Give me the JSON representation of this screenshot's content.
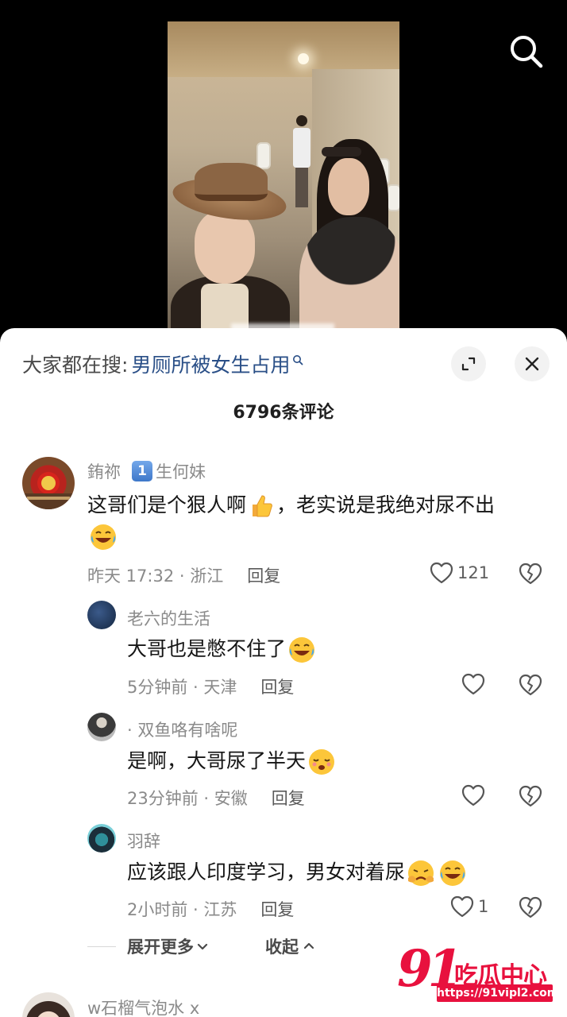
{
  "search_suggestion": {
    "label": "大家都在搜:",
    "term": "男厕所被女生占用"
  },
  "comment_count": "6796条评论",
  "comments": [
    {
      "username": "銪祢",
      "badge": "1",
      "badge_text": "生何妹",
      "text": "这哥们是个狠人啊",
      "text_after_emoji": "，老实说是我绝对尿不出",
      "emojis": [
        "thumbs-up",
        "crying-laughing"
      ],
      "time_location": "昨天 17:32 · 浙江",
      "reply_label": "回复",
      "likes": "121"
    },
    {
      "username": "老六的生活",
      "text": "大哥也是憋不住了",
      "emojis": [
        "crying-laughing"
      ],
      "time_location": "5分钟前 · 天津",
      "reply_label": "回复"
    },
    {
      "username": "· 双鱼咯有啥呢",
      "text": "是啊，大哥尿了半天",
      "emojis": [
        "sleepy-face"
      ],
      "time_location": "23分钟前 · 安徽",
      "reply_label": "回复"
    },
    {
      "username": "羽辞",
      "text": "应该跟人印度学习，男女对着尿",
      "emojis": [
        "facepalm-face",
        "crying-laughing"
      ],
      "time_location": "2小时前 · 江苏",
      "reply_label": "回复",
      "likes": "1"
    },
    {
      "username": "w石榴气泡水 x"
    }
  ],
  "expand_more_label": "展开更多",
  "collapse_label": "收起",
  "watermark": {
    "number": "91",
    "brand": "吃瓜中心",
    "url": "https://91vipl2.com"
  },
  "colors": {
    "link_blue": "#2a4f87",
    "meta_gray": "#8a8a8a",
    "watermark_red": "#e8113e"
  }
}
